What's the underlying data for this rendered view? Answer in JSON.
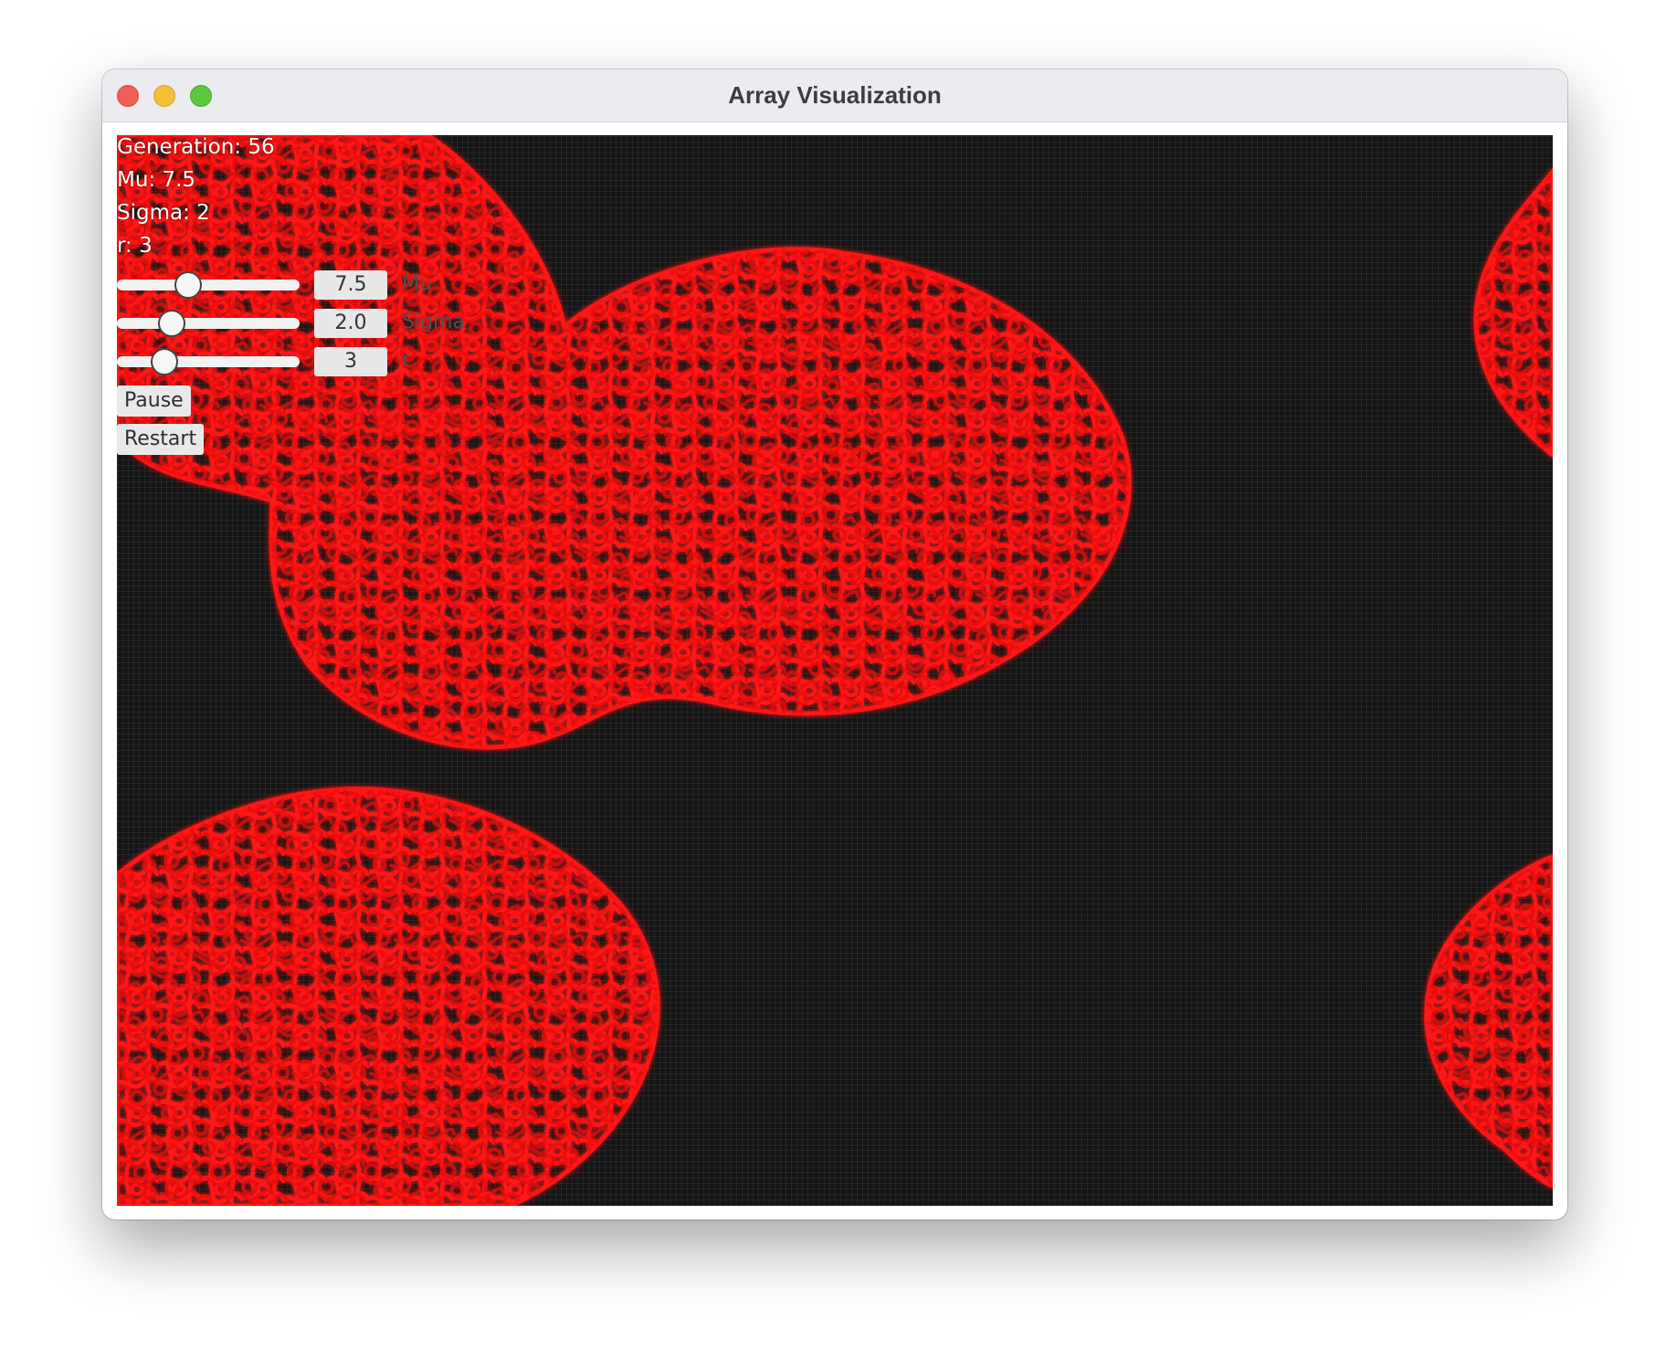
{
  "window": {
    "title": "Array Visualization"
  },
  "stats": {
    "generation": "Generation: 56",
    "mu": "Mu: 7.5",
    "sigma": "Sigma: 2",
    "r": "r: 3"
  },
  "controls": {
    "mu": {
      "value_text": "7.5",
      "label": "Mu",
      "fraction": 0.39
    },
    "sigma": {
      "value_text": "2.0",
      "label": "Sigma",
      "fraction": 0.3
    },
    "r": {
      "value_text": "3",
      "label": "r",
      "fraction": 0.26
    }
  },
  "buttons": {
    "pause": "Pause",
    "restart": "Restart"
  },
  "colors": {
    "cell": "#ff1010",
    "background": "#151515"
  }
}
